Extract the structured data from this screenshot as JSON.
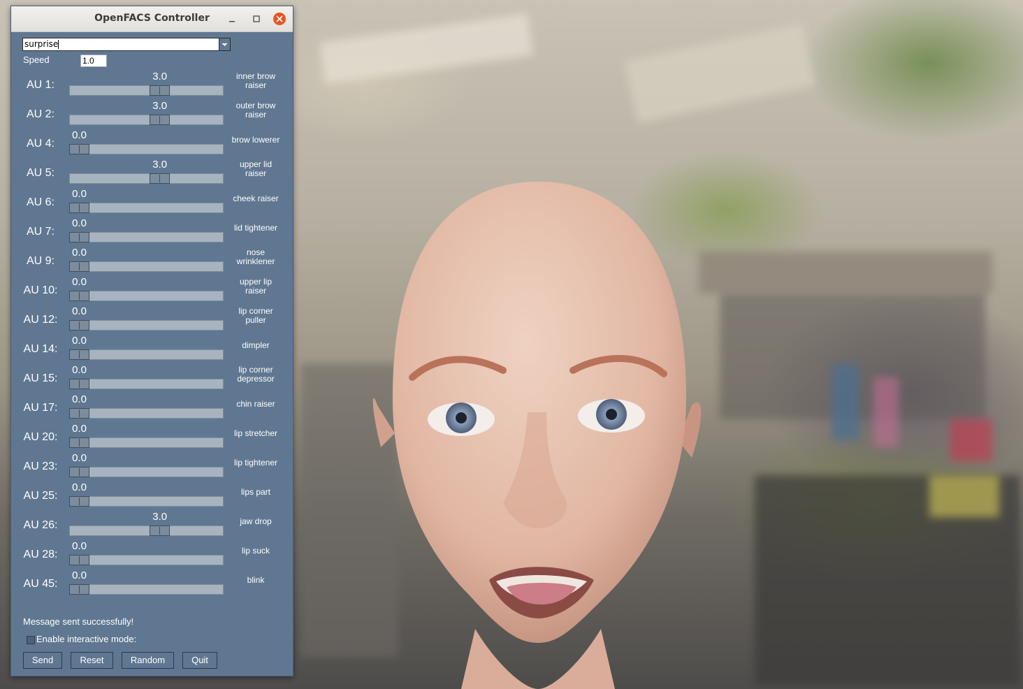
{
  "window": {
    "title": "OpenFACS Controller",
    "close_color": "#e95420",
    "panel_color": "#607791"
  },
  "preset": {
    "value": "surprise"
  },
  "speed": {
    "label": "Speed",
    "value": "1.0"
  },
  "slider": {
    "min": 0.0,
    "max": 5.0
  },
  "aus": [
    {
      "label": "AU 1:",
      "value": "3.0",
      "level": 3.0,
      "desc": "inner brow raiser"
    },
    {
      "label": "AU 2:",
      "value": "3.0",
      "level": 3.0,
      "desc": "outer brow raiser"
    },
    {
      "label": "AU 4:",
      "value": "0.0",
      "level": 0.0,
      "desc": "brow lowerer"
    },
    {
      "label": "AU 5:",
      "value": "3.0",
      "level": 3.0,
      "desc": "upper lid raiser"
    },
    {
      "label": "AU 6:",
      "value": "0.0",
      "level": 0.0,
      "desc": "cheek raiser"
    },
    {
      "label": "AU 7:",
      "value": "0.0",
      "level": 0.0,
      "desc": "lid tightener"
    },
    {
      "label": "AU 9:",
      "value": "0.0",
      "level": 0.0,
      "desc": "nose wrinklener"
    },
    {
      "label": "AU 10:",
      "value": "0.0",
      "level": 0.0,
      "desc": "upper lip raiser"
    },
    {
      "label": "AU 12:",
      "value": "0.0",
      "level": 0.0,
      "desc": "lip corner puller"
    },
    {
      "label": "AU 14:",
      "value": "0.0",
      "level": 0.0,
      "desc": "dimpler"
    },
    {
      "label": "AU 15:",
      "value": "0.0",
      "level": 0.0,
      "desc": "lip corner depressor"
    },
    {
      "label": "AU 17:",
      "value": "0.0",
      "level": 0.0,
      "desc": "chin raiser"
    },
    {
      "label": "AU 20:",
      "value": "0.0",
      "level": 0.0,
      "desc": "lip stretcher"
    },
    {
      "label": "AU 23:",
      "value": "0.0",
      "level": 0.0,
      "desc": "lip tightener"
    },
    {
      "label": "AU 25:",
      "value": "0.0",
      "level": 0.0,
      "desc": "lips part"
    },
    {
      "label": "AU 26:",
      "value": "3.0",
      "level": 3.0,
      "desc": "jaw drop"
    },
    {
      "label": "AU 28:",
      "value": "0.0",
      "level": 0.0,
      "desc": "lip suck"
    },
    {
      "label": "AU 45:",
      "value": "0.0",
      "level": 0.0,
      "desc": "blink"
    }
  ],
  "status": {
    "message": "Message sent successfully!"
  },
  "interactive": {
    "label": "Enable interactive mode:",
    "checked": false
  },
  "buttons": {
    "send": "Send",
    "reset": "Reset",
    "random": "Random",
    "quit": "Quit"
  }
}
